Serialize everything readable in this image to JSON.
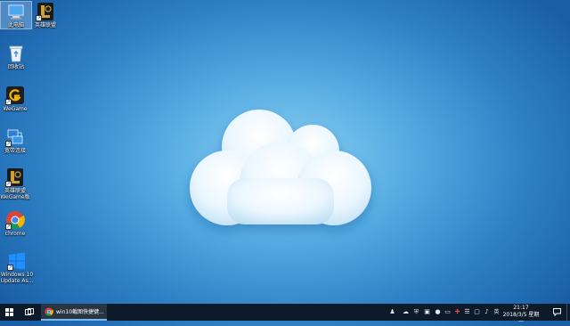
{
  "desktop_icons": [
    {
      "label": "此电脑",
      "icon": "computer-icon",
      "selected": true
    },
    {
      "label": "英雄联盟",
      "icon": "lol-icon"
    },
    {
      "label": "回收站",
      "icon": "recycle-bin-icon"
    },
    {
      "label": "WeGame",
      "icon": "wegame-icon"
    },
    {
      "label": "宽带连接",
      "icon": "network-icon"
    },
    {
      "label": "英雄联盟WeGame版",
      "icon": "lol-icon"
    },
    {
      "label": "chrome",
      "icon": "chrome-icon"
    },
    {
      "label": "Windows 10 Update As...",
      "icon": "windows-update-icon"
    }
  ],
  "taskbar": {
    "start_icon": "windows-start-icon",
    "task_view_icon": "task-view-icon",
    "active_window": {
      "label": "win10截图快捷键...",
      "icon": "chrome-icon"
    },
    "tray": {
      "input_method": "英",
      "time": "21:17",
      "date": "2018/3/5 星期一"
    }
  },
  "colors": {
    "taskbar": "#0d1a2a",
    "accent": "#76b9ed",
    "wallpaper_center": "#8fd0f2",
    "wallpaper_edge": "#1a5fa6"
  }
}
